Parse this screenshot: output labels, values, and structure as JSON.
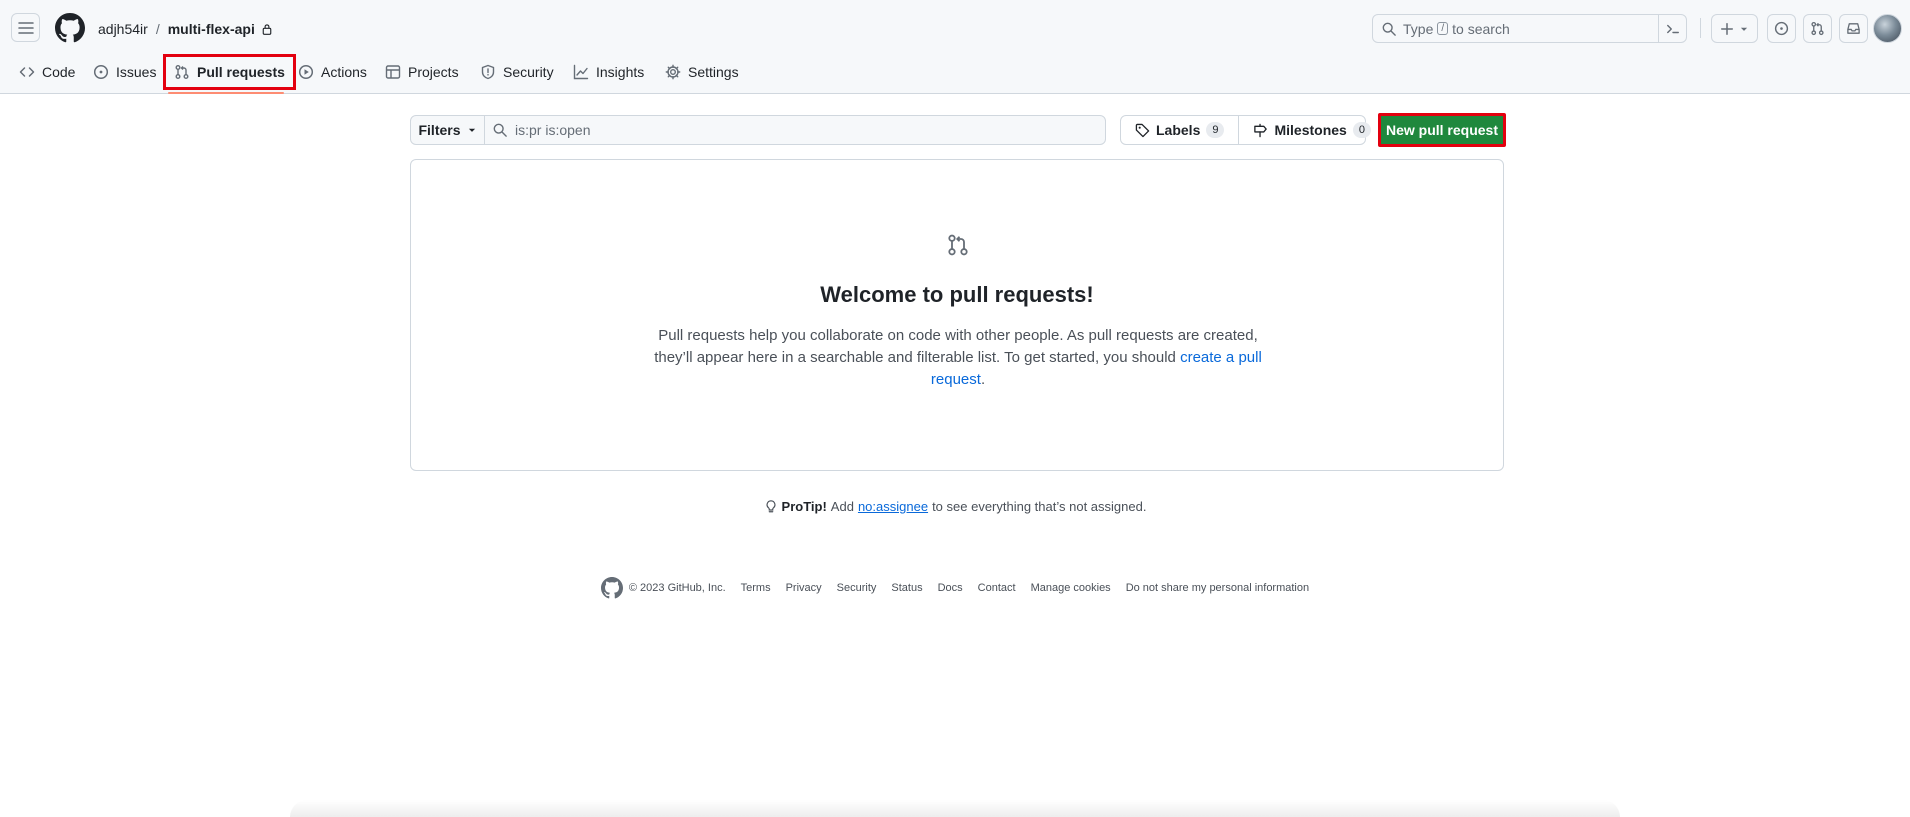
{
  "header": {
    "owner": "adjh54ir",
    "separator": "/",
    "repo": "multi-flex-api",
    "search": {
      "prefix": "Type",
      "key": "/",
      "suffix": "to search"
    }
  },
  "nav": {
    "items": [
      {
        "label": "Code",
        "icon": "code-icon"
      },
      {
        "label": "Issues",
        "icon": "issue-opened-icon"
      },
      {
        "label": "Pull requests",
        "icon": "git-pull-request-icon"
      },
      {
        "label": "Actions",
        "icon": "play-icon"
      },
      {
        "label": "Projects",
        "icon": "table-icon"
      },
      {
        "label": "Security",
        "icon": "shield-icon"
      },
      {
        "label": "Insights",
        "icon": "graph-icon"
      },
      {
        "label": "Settings",
        "icon": "gear-icon"
      }
    ],
    "selected": "Pull requests"
  },
  "toolbar": {
    "filters_label": "Filters",
    "filter_query": "is:pr is:open",
    "labels_label": "Labels",
    "labels_count": "9",
    "milestones_label": "Milestones",
    "milestones_count": "0",
    "new_pr_label": "New pull request"
  },
  "blankslate": {
    "title": "Welcome to pull requests!",
    "text_before": "Pull requests help you collaborate on code with other people. As pull requests are created, they’ll appear here in a searchable and filterable list. To get started, you should",
    "link": "create a pull request",
    "text_after": "."
  },
  "protip": {
    "strong": "ProTip!",
    "before": "Add",
    "link": "no:assignee",
    "after": "to see everything that’s not assigned."
  },
  "footer": {
    "copyright": "© 2023 GitHub, Inc.",
    "links": [
      "Terms",
      "Privacy",
      "Security",
      "Status",
      "Docs",
      "Contact",
      "Manage cookies",
      "Do not share my personal information"
    ]
  },
  "colors": {
    "accent": "#0969da",
    "primary_button": "#1f883d",
    "highlight": "#e3000f",
    "nav_underline": "#fd8c73"
  }
}
